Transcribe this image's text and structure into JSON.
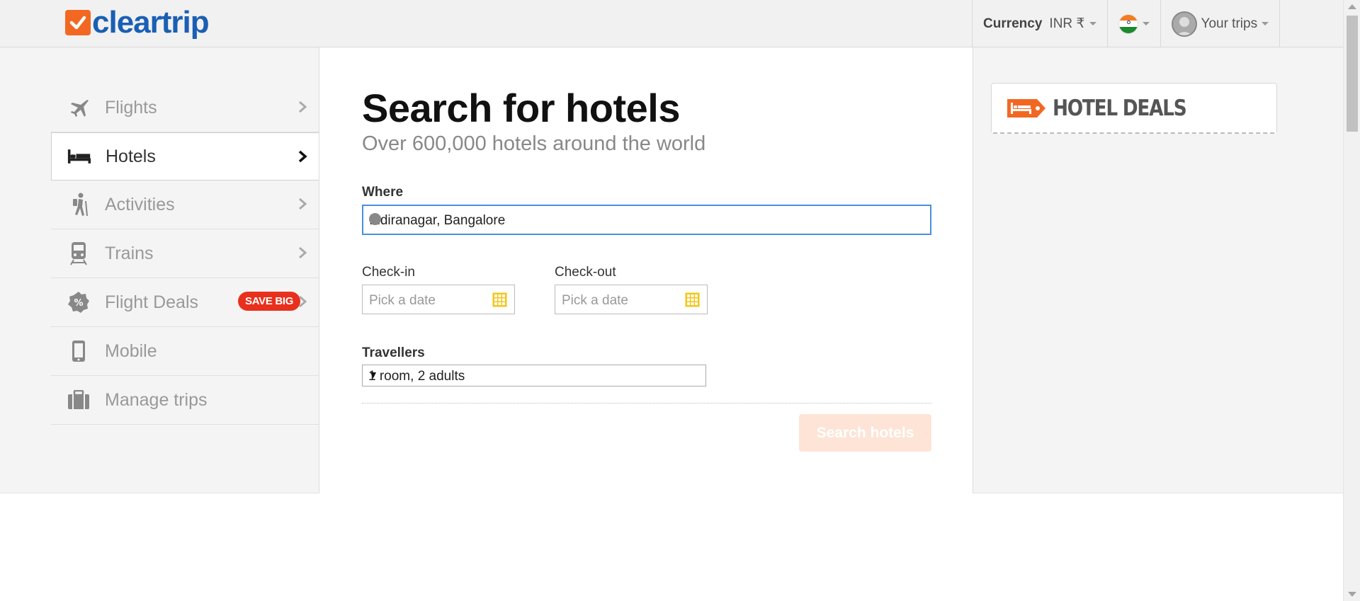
{
  "header": {
    "logo_text": "cleartrip",
    "currency_label": "Currency",
    "currency_value": "INR ₹",
    "your_trips": "Your trips"
  },
  "sidebar": {
    "items": [
      {
        "label": "Flights",
        "icon": "plane-icon",
        "active": false
      },
      {
        "label": "Hotels",
        "icon": "bed-icon",
        "active": true
      },
      {
        "label": "Activities",
        "icon": "hiker-icon",
        "active": false
      },
      {
        "label": "Trains",
        "icon": "train-icon",
        "active": false
      },
      {
        "label": "Flight Deals",
        "icon": "percent-badge-icon",
        "active": false,
        "badge": "SAVE BIG"
      },
      {
        "label": "Mobile",
        "icon": "mobile-icon",
        "active": false
      },
      {
        "label": "Manage trips",
        "icon": "briefcase-icon",
        "active": false
      }
    ]
  },
  "search": {
    "title": "Search for hotels",
    "subtitle": "Over 600,000 hotels around the world",
    "where_label": "Where",
    "where_value": "Indiranagar, Bangalore",
    "checkin_label": "Check-in",
    "checkin_placeholder": "Pick a date",
    "checkout_label": "Check-out",
    "checkout_placeholder": "Pick a date",
    "travellers_label": "Travellers",
    "travellers_value": "1 room, 2 adults",
    "search_button": "Search hotels"
  },
  "deals": {
    "label": "HOTEL DEALS"
  },
  "colors": {
    "brand_orange": "#f26822",
    "brand_blue": "#1a5fb4",
    "badge_red": "#e8301c",
    "input_focus": "#4a90d9"
  }
}
